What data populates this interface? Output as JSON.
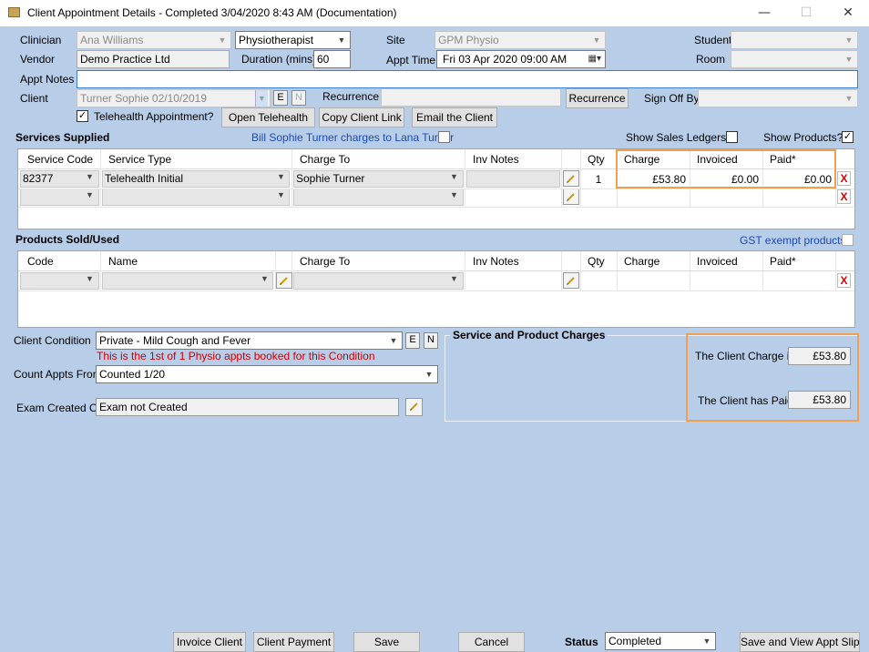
{
  "window": {
    "title": "Client Appointment Details - Completed 3/04/2020 8:43 AM (Documentation)",
    "minimize": "—",
    "maximize": "☐",
    "close": "✕"
  },
  "header": {
    "clinician_label": "Clinician",
    "clinician_value": "Ana Williams",
    "profession_value": "Physiotherapist",
    "site_label": "Site",
    "site_value": "GPM Physio",
    "student_label": "Student",
    "student_value": "",
    "vendor_label": "Vendor",
    "vendor_value": "Demo Practice Ltd",
    "duration_label": "Duration (mins)",
    "duration_value": "60",
    "appt_time_label": "Appt Time",
    "appt_time_value": "Fri   03  Apr  2020 09:00 AM",
    "room_label": "Room",
    "room_value": "",
    "appt_notes_label": "Appt Notes",
    "appt_notes_value": "",
    "client_label": "Client",
    "client_value": "Turner Sophie 02/10/2019",
    "e_button": "E",
    "n_button": "N",
    "recurrence_label": "Recurrence",
    "recurrence_value": "",
    "recurrence_button": "Recurrence",
    "sign_off_label": "Sign Off By",
    "sign_off_value": "",
    "telehealth_label": "Telehealth Appointment?",
    "telehealth_checked": "✓",
    "open_telehealth": "Open Telehealth",
    "copy_client_link": "Copy Client Link",
    "email_client": "Email the Client"
  },
  "services": {
    "title": "Services Supplied",
    "bill_note": "Bill Sophie Turner charges to Lana Turner",
    "show_sales_label": "Show Sales Ledgers?",
    "show_products_label": "Show Products?",
    "show_products_checked": "✓",
    "columns": [
      "Service Code",
      "Service Type",
      "Charge To",
      "Inv Notes",
      "Qty",
      "Charge",
      "Invoiced",
      "Paid*"
    ],
    "rows": [
      {
        "code": "82377",
        "type": "Telehealth Initial",
        "charge_to": "Sophie Turner",
        "inv_notes": "",
        "qty": "1",
        "charge": "£53.80",
        "invoiced": "£0.00",
        "paid": "£0.00"
      },
      {
        "code": "",
        "type": "",
        "charge_to": "",
        "inv_notes": "",
        "qty": "",
        "charge": "",
        "invoiced": "",
        "paid": ""
      }
    ],
    "delete_glyph": "X"
  },
  "products": {
    "title": "Products Sold/Used",
    "gst_link": "GST exempt products",
    "columns": [
      "Code",
      "Name",
      "Charge To",
      "Inv Notes",
      "Qty",
      "Charge",
      "Invoiced",
      "Paid*"
    ],
    "delete_glyph": "X"
  },
  "condition": {
    "label": "Client Condition",
    "value": "Private - Mild Cough and Fever",
    "e_button": "E",
    "n_button": "N",
    "warning": "This is the 1st of 1 Physio appts booked for this Condition",
    "count_label": "Count Appts From",
    "count_value": "Counted 1/20",
    "exam_label": "Exam Created On",
    "exam_value": "Exam not Created"
  },
  "charges": {
    "title": "Service and Product Charges",
    "client_charge_label": "The Client Charge is",
    "client_charge_value": "£53.80",
    "client_paid_label": "The Client has Paid",
    "client_paid_value": "£53.80"
  },
  "footer": {
    "invoice_client": "Invoice Client",
    "client_payment": "Client Payment",
    "save": "Save",
    "cancel": "Cancel",
    "status_label": "Status",
    "status_value": "Completed",
    "save_view_slip": "Save and View Appt Slip"
  },
  "icons": {
    "dropdown": "▼"
  }
}
